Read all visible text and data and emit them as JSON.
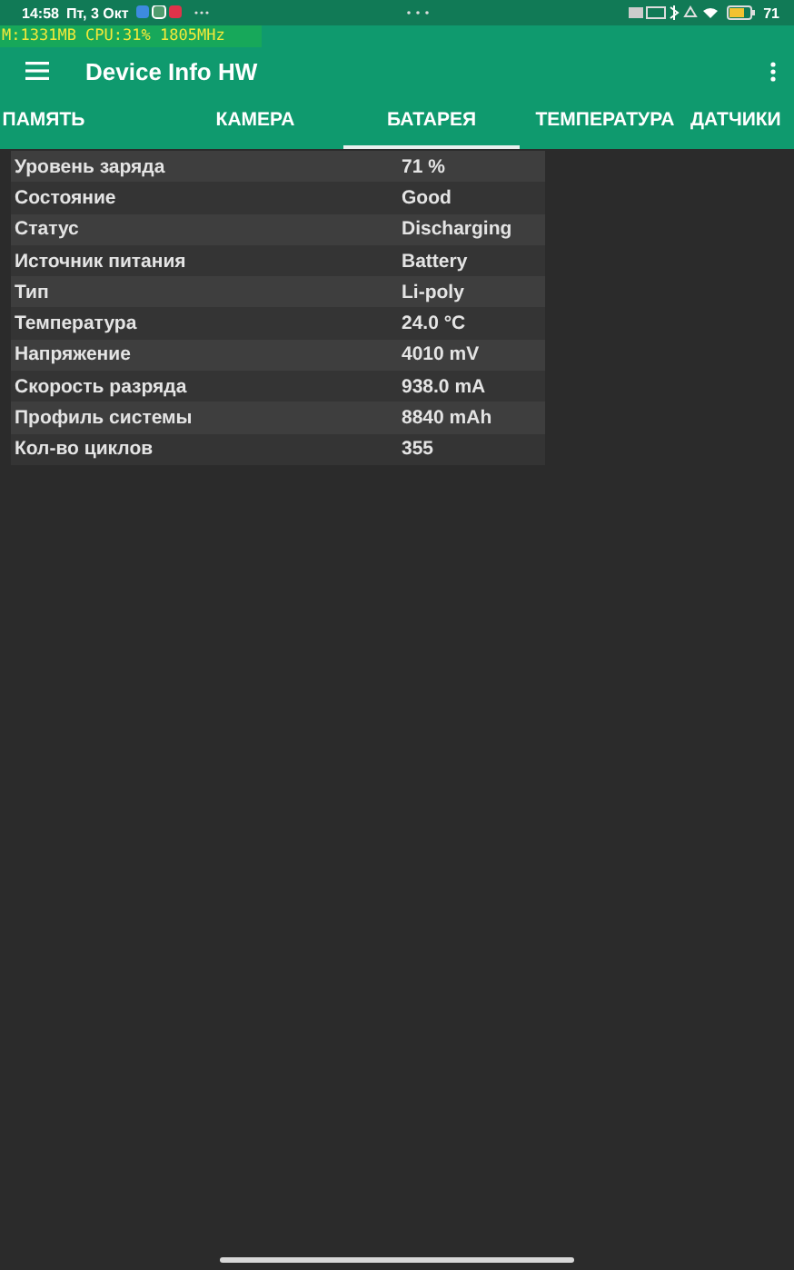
{
  "status_bar": {
    "time": "14:58",
    "date": "Пт, 3 Окт",
    "battery_text": "71"
  },
  "overlay": {
    "text": "M:1331MB CPU:31%  1805MHz"
  },
  "app_bar": {
    "title": "Device Info HW"
  },
  "tabs": [
    {
      "label": "ПАМЯТЬ",
      "selected": false
    },
    {
      "label": "КАМЕРА",
      "selected": false
    },
    {
      "label": "БАТАРЕЯ",
      "selected": true
    },
    {
      "label": "ТЕМПЕРАТУРА",
      "selected": false
    },
    {
      "label": "ДАТЧИКИ",
      "selected": false
    }
  ],
  "table": {
    "rows": [
      {
        "label": "Уровень заряда",
        "value": "71 %"
      },
      {
        "label": "Состояние",
        "value": "Good"
      },
      {
        "label": "Статус",
        "value": "Discharging"
      },
      {
        "label": "Источник питания",
        "value": "Battery"
      },
      {
        "label": "Тип",
        "value": "Li-poly"
      },
      {
        "label": "Температура",
        "value": "24.0 °C"
      },
      {
        "label": "Напряжение",
        "value": "4010 mV"
      },
      {
        "label": "Скорость разряда",
        "value": "938.0 mA"
      },
      {
        "label": "Профиль системы",
        "value": "8840 mAh"
      },
      {
        "label": "Кол-во циклов",
        "value": "355"
      }
    ]
  }
}
